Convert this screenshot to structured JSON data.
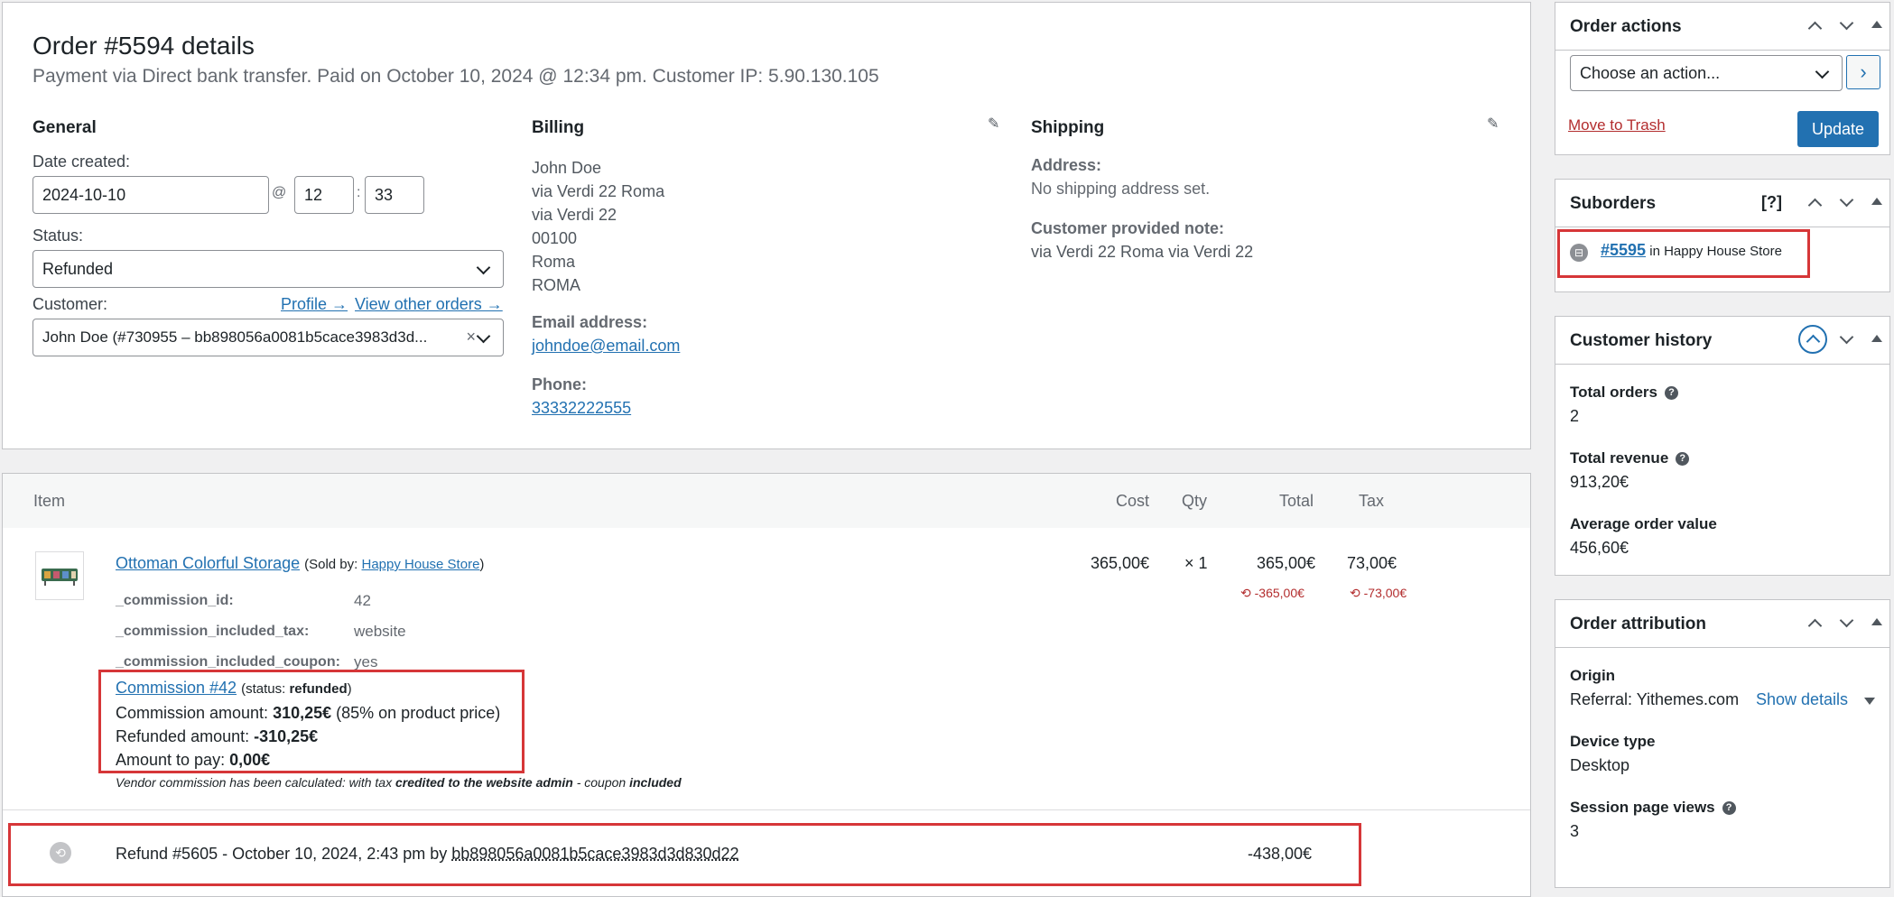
{
  "order": {
    "title": "Order #5594 details",
    "subtitle": "Payment via Direct bank transfer. Paid on October 10, 2024 @ 12:34 pm. Customer IP: 5.90.130.105"
  },
  "general": {
    "heading": "General",
    "date_label": "Date created:",
    "date_value": "2024-10-10",
    "at": "@",
    "hour": "12",
    "colon": ":",
    "minute": "33",
    "status_label": "Status:",
    "status_value": "Refunded",
    "customer_label": "Customer:",
    "profile_link": "Profile →",
    "other_orders_link": "View other orders →",
    "customer_value": "John Doe (#730955 – bb898056a0081b5cace3983d3d...",
    "clear": "×"
  },
  "billing": {
    "heading": "Billing",
    "address": [
      "John Doe",
      "via Verdi 22 Roma",
      "via Verdi 22",
      "00100",
      "Roma",
      "ROMA"
    ],
    "email_label": "Email address:",
    "email": "johndoe@email.com",
    "phone_label": "Phone:",
    "phone": "33332222555"
  },
  "shipping": {
    "heading": "Shipping",
    "address_label": "Address:",
    "address_value": "No shipping address set.",
    "note_label": "Customer provided note:",
    "note_value": "via Verdi 22 Roma via Verdi 22"
  },
  "items": {
    "col_item": "Item",
    "col_cost": "Cost",
    "col_qty": "Qty",
    "col_total": "Total",
    "col_tax": "Tax",
    "product_name": "Ottoman Colorful Storage",
    "sold_by_prefix": "(Sold by: ",
    "vendor": "Happy House Store",
    "sold_by_suffix": ")",
    "cost": "365,00€",
    "qty": "× 1",
    "total": "365,00€",
    "tax": "73,00€",
    "refund_total": "-365,00€",
    "refund_tax": "-73,00€",
    "meta": [
      {
        "key": "_commission_id:",
        "value": "42"
      },
      {
        "key": "_commission_included_tax:",
        "value": "website"
      },
      {
        "key": "_commission_included_coupon:",
        "value": "yes"
      }
    ],
    "commission_link": "Commission #42",
    "commission_status_prefix": "(status: ",
    "commission_status": "refunded",
    "commission_status_suffix": ")",
    "commission_amount_label": "Commission amount: ",
    "commission_amount": "310,25€",
    "commission_amount_note": " (85% on product price)",
    "refunded_label": "Refunded amount: ",
    "refunded_value": "-310,25€",
    "to_pay_label": "Amount to pay: ",
    "to_pay_value": "0,00€",
    "vendor_note_1": "Vendor commission has been calculated: with tax ",
    "vendor_note_2": "credited to the website admin",
    "vendor_note_3": " - coupon ",
    "vendor_note_4": "included",
    "refund_line_prefix": "Refund #5605 - October 10, 2024, 2:43 pm by ",
    "refund_line_user": "bb898056a0081b5cace3983d3d830d22",
    "refund_line_amount": "-438,00€"
  },
  "sidebar": {
    "order_actions": {
      "title": "Order actions",
      "select_value": "Choose an action...",
      "go": "›",
      "trash": "Move to Trash",
      "update": "Update"
    },
    "suborders": {
      "title": "Suborders",
      "help": "[?]",
      "order_link": "#5595",
      "in_store": " in Happy House Store"
    },
    "customer_history": {
      "title": "Customer history",
      "total_orders_label": "Total orders",
      "total_orders": "2",
      "total_revenue_label": "Total revenue",
      "total_revenue": "913,20€",
      "avg_label": "Average order value",
      "avg_value": "456,60€"
    },
    "attribution": {
      "title": "Order attribution",
      "origin_label": "Origin",
      "origin_value": "Referral: Yithemes.com",
      "show_details": "Show details",
      "device_label": "Device type",
      "device_value": "Desktop",
      "views_label": "Session page views",
      "views_value": "3"
    }
  },
  "colors": {
    "accent": "#2271b1",
    "highlight": "#d63638",
    "refund": "#b32d2e"
  }
}
